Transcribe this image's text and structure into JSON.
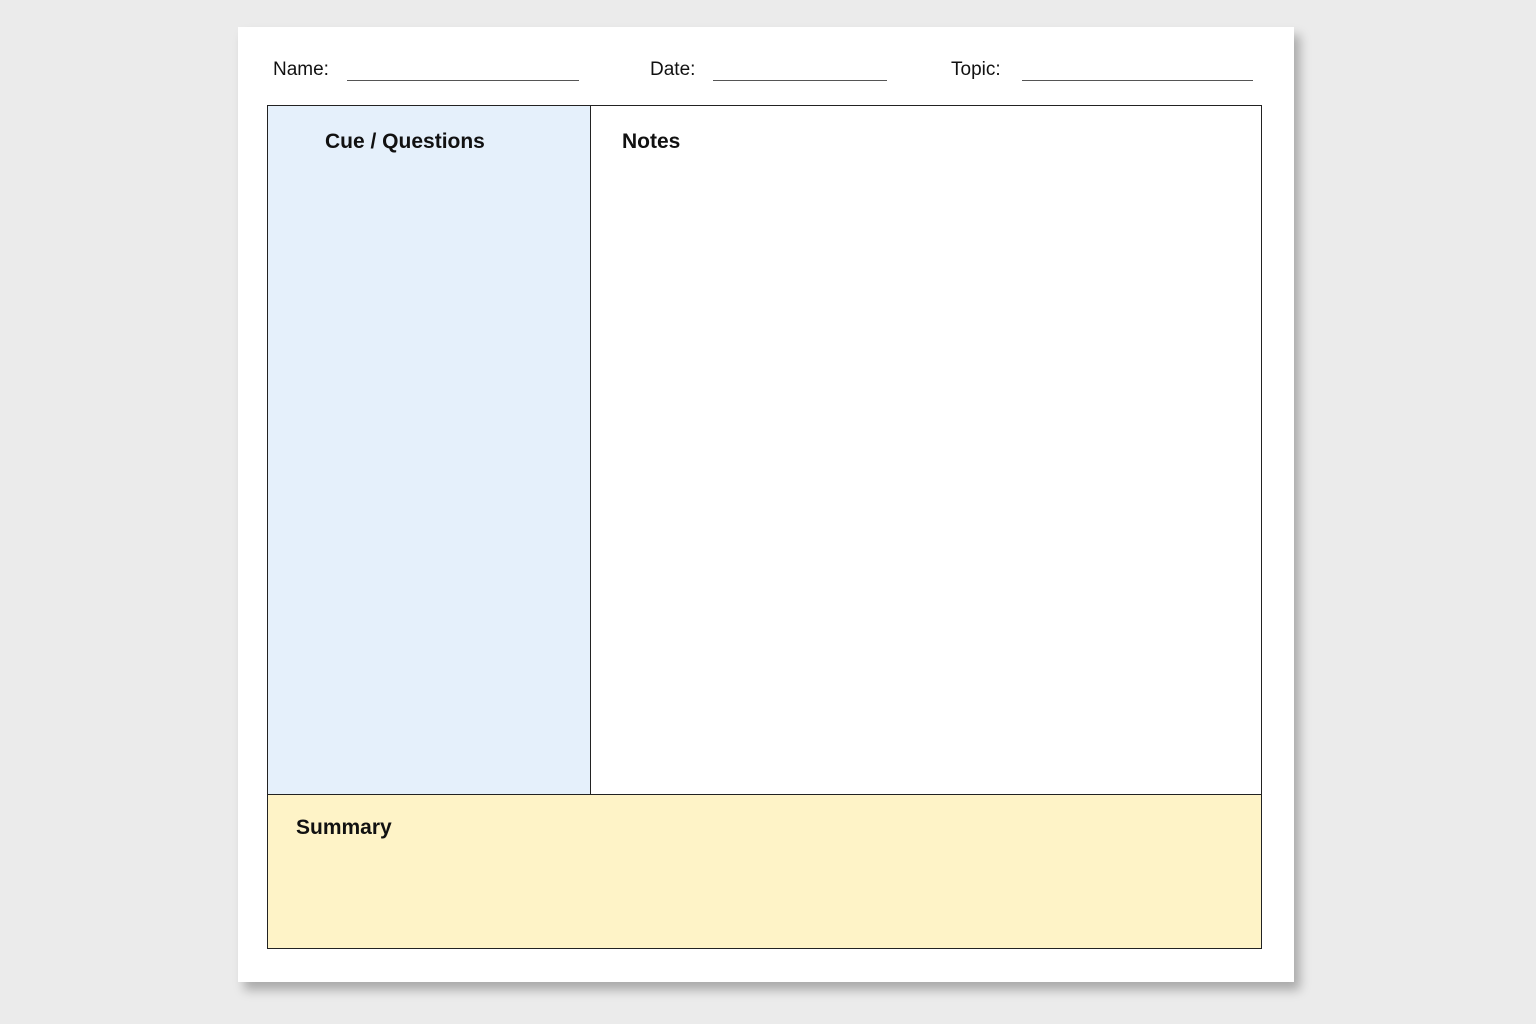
{
  "header": {
    "name_label": "Name:",
    "date_label": "Date:",
    "topic_label": "Topic:"
  },
  "sections": {
    "cue_title": "Cue / Questions",
    "notes_title": "Notes",
    "summary_title": "Summary"
  },
  "colors": {
    "cue_background": "#e5f0fb",
    "notes_background": "#ffffff",
    "summary_background": "#fef3c7",
    "page_background": "#ebebeb",
    "sheet_background": "#ffffff"
  }
}
